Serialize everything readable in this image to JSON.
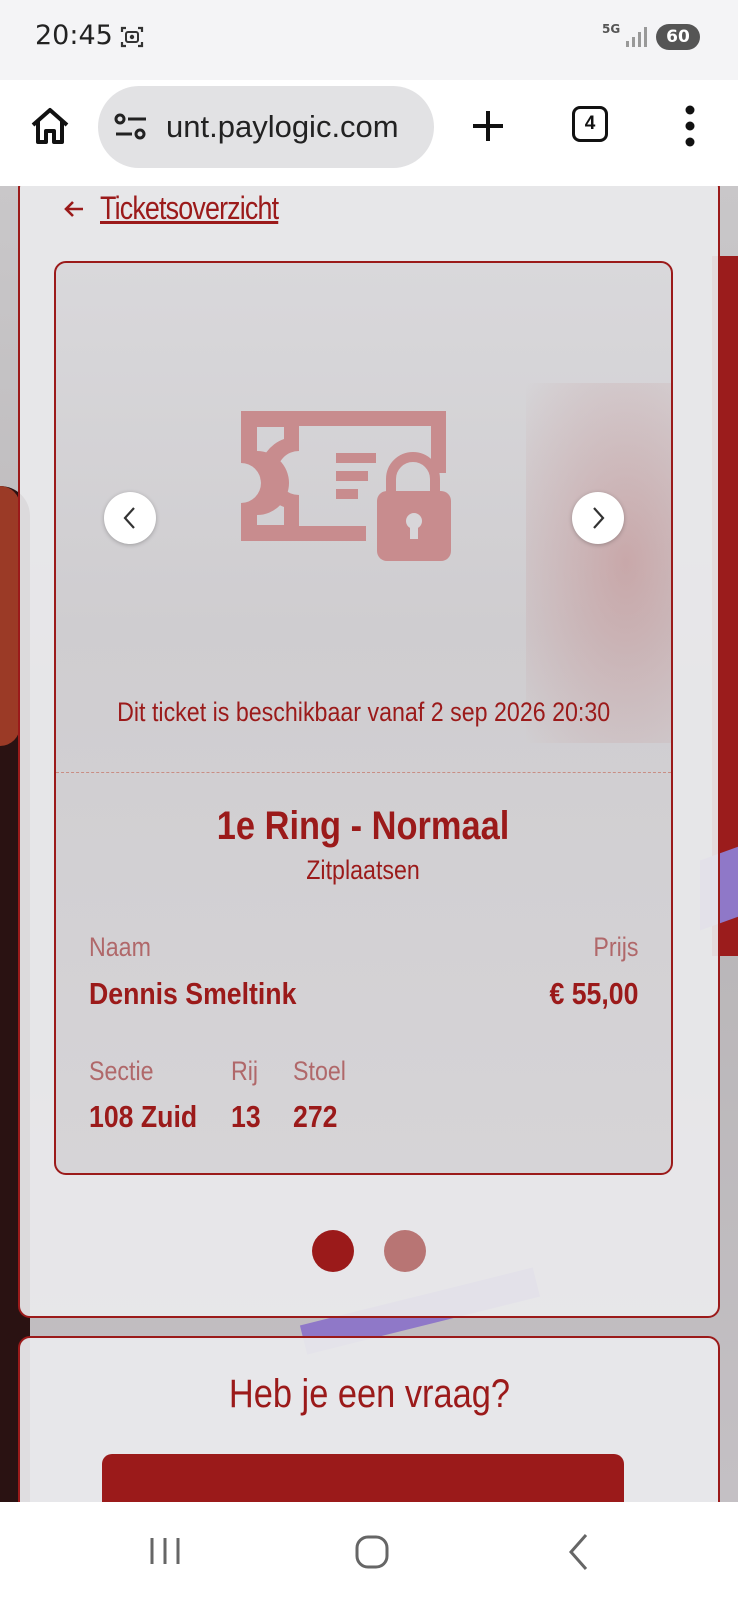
{
  "status_bar": {
    "time": "20:45",
    "network": "5G",
    "battery": "60",
    "icons": [
      "screen-record-icon",
      "signal-icon"
    ]
  },
  "browser": {
    "url": "unt.paylogic.com",
    "tab_count": "4",
    "icons": [
      "home-icon",
      "site-settings-icon",
      "plus-icon",
      "more-vert-icon"
    ]
  },
  "page": {
    "back_link": "Ticketsoverzicht",
    "ticket": {
      "availability": "Dit ticket is beschikbaar vanaf 2 sep 2026 20:30",
      "type": "1e Ring - Normaal",
      "subtype": "Zitplaatsen",
      "name_label": "Naam",
      "name_value": "Dennis Smeltink",
      "price_label": "Prijs",
      "price_value": "€ 55,00",
      "section_label": "Sectie",
      "section_value": "108 Zuid",
      "row_label": "Rij",
      "row_value": "13",
      "seat_label": "Stoel",
      "seat_value": "272"
    },
    "carousel": {
      "page_count": 2,
      "active_index": 0
    },
    "help": {
      "title": "Heb je een vraag?"
    }
  },
  "colors": {
    "brand": "#9b1a1a",
    "brand_light": "#b87574",
    "muted_label": "#b0686a"
  }
}
